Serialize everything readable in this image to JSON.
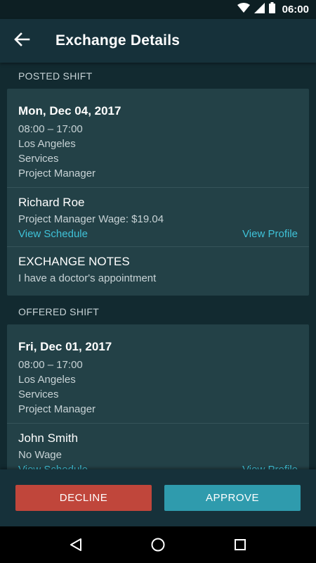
{
  "status_bar": {
    "time": "06:00"
  },
  "app_bar": {
    "title": "Exchange Details"
  },
  "posted": {
    "section_label": "POSTED SHIFT",
    "date": "Mon, Dec 04, 2017",
    "time": "08:00 – 17:00",
    "location": "Los Angeles",
    "department": "Services",
    "position": "Project Manager",
    "person_name": "Richard Roe",
    "wage": "Project Manager Wage: $19.04",
    "view_schedule": "View Schedule",
    "view_profile": "View Profile",
    "notes_title": "EXCHANGE NOTES",
    "notes_text": "I have a doctor's appointment"
  },
  "offered": {
    "section_label": "OFFERED SHIFT",
    "date": "Fri, Dec 01, 2017",
    "time": "08:00 – 17:00",
    "location": "Los Angeles",
    "department": "Services",
    "position": "Project Manager",
    "person_name": "John Smith",
    "wage": "No Wage",
    "view_schedule": "View Schedule",
    "view_profile": "View Profile"
  },
  "actions": {
    "decline": "DECLINE",
    "approve": "APPROVE"
  },
  "colors": {
    "background": "#122a30",
    "card": "#234147",
    "link": "#3fc2d8",
    "decline": "#c0463b",
    "approve": "#2f9bad"
  },
  "icons": {
    "status": [
      "wifi-icon",
      "signal-icon",
      "battery-icon"
    ],
    "back": "arrow-left-icon",
    "nav": [
      "nav-back-icon",
      "nav-home-icon",
      "nav-recents-icon"
    ]
  }
}
